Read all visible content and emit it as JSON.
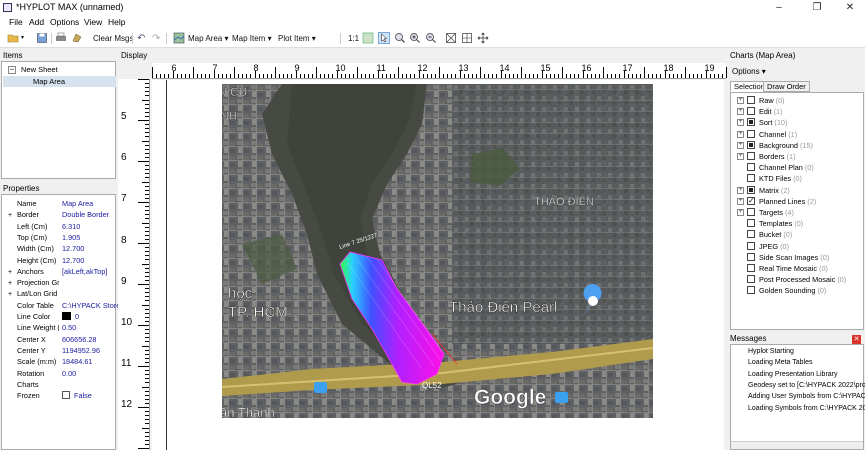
{
  "window": {
    "title": "*HYPLOT MAX (unnamed)"
  },
  "menu": [
    "File",
    "Add",
    "Options",
    "View",
    "Help"
  ],
  "toolbar": {
    "clear_msgs": "Clear Msgs",
    "map_area": "Map Area",
    "map_item": "Map Item",
    "plot_item": "Plot Item",
    "scale_1to1": "1:1"
  },
  "items": {
    "header": "Items",
    "sheet": "New Sheet",
    "map_area": "Map Area"
  },
  "properties": {
    "header": "Properties",
    "rows": [
      {
        "name": "Name",
        "value": "Map Area",
        "expand": ""
      },
      {
        "name": "Border",
        "value": "Double Border",
        "expand": "+"
      },
      {
        "name": "Left (Cm)",
        "value": "6.310",
        "expand": ""
      },
      {
        "name": "Top (Cm)",
        "value": "1.905",
        "expand": ""
      },
      {
        "name": "Width (Cm)",
        "value": "12.700",
        "expand": ""
      },
      {
        "name": "Height (Cm)",
        "value": "12.700",
        "expand": ""
      },
      {
        "name": "Anchors",
        "value": "[akLeft,akTop]",
        "expand": "+"
      },
      {
        "name": "Projection Gri",
        "value": "",
        "expand": "+"
      },
      {
        "name": "Lat/Lon Grid",
        "value": "",
        "expand": "+"
      },
      {
        "name": "Color Table",
        "value": "C:\\HYPACK Store",
        "expand": ""
      },
      {
        "name": "Line Color",
        "value": "0",
        "expand": ""
      },
      {
        "name": "Line Weight (",
        "value": "0.50",
        "expand": ""
      },
      {
        "name": "Center X",
        "value": "606656.28",
        "expand": ""
      },
      {
        "name": "Center Y",
        "value": "1194952.96",
        "expand": ""
      },
      {
        "name": "Scale (m:m)",
        "value": "18484.61",
        "expand": ""
      },
      {
        "name": "Rotation",
        "value": "0.00",
        "expand": ""
      },
      {
        "name": "Charts",
        "value": "",
        "expand": ""
      },
      {
        "name": "Frozen",
        "value": "False",
        "expand": ""
      }
    ]
  },
  "display": {
    "header": "Display",
    "h_ticks": [
      "6",
      "7",
      "8",
      "9",
      "10",
      "11",
      "12",
      "13",
      "14",
      "15",
      "16",
      "17",
      "18",
      "19"
    ],
    "v_ticks": [
      "5",
      "6",
      "7",
      "8",
      "9",
      "10",
      "11",
      "12"
    ]
  },
  "map": {
    "labels": [
      "N CƯ",
      "NH",
      "THẢO ĐIỀN",
      "học",
      "TP. HCM...",
      "Thảo Điền Pearl",
      "Google",
      "QL52",
      "ăn Thánh"
    ],
    "line_label": "Line 7 25/1227"
  },
  "charts": {
    "header": "Charts (Map Area)",
    "options": "Options",
    "tabs": [
      "Selection",
      "Draw Order"
    ],
    "rows": [
      {
        "label": "Raw",
        "count": "(0)",
        "expand": true,
        "check": "none"
      },
      {
        "label": "Edit",
        "count": "(1)",
        "expand": true,
        "check": "none"
      },
      {
        "label": "Sort",
        "count": "(10)",
        "expand": true,
        "check": "partial"
      },
      {
        "label": "Channel",
        "count": "(1)",
        "expand": true,
        "check": "none"
      },
      {
        "label": "Background",
        "count": "(15)",
        "expand": true,
        "check": "partial"
      },
      {
        "label": "Borders",
        "count": "(1)",
        "expand": true,
        "check": "none"
      },
      {
        "label": "Channel Plan",
        "count": "(0)",
        "expand": false,
        "check": "none"
      },
      {
        "label": "KTD Files",
        "count": "(0)",
        "expand": false,
        "check": "none"
      },
      {
        "label": "Matrix",
        "count": "(2)",
        "expand": true,
        "check": "partial"
      },
      {
        "label": "Planned Lines",
        "count": "(2)",
        "expand": true,
        "check": "tick"
      },
      {
        "label": "Targets",
        "count": "(4)",
        "expand": true,
        "check": "none"
      },
      {
        "label": "Templates",
        "count": "(0)",
        "expand": false,
        "check": "none"
      },
      {
        "label": "Bucket",
        "count": "(0)",
        "expand": false,
        "check": "none"
      },
      {
        "label": "JPEG",
        "count": "(0)",
        "expand": false,
        "check": "none"
      },
      {
        "label": "Side Scan Images",
        "count": "(0)",
        "expand": false,
        "check": "none"
      },
      {
        "label": "Real Time Mosaic",
        "count": "(0)",
        "expand": false,
        "check": "none"
      },
      {
        "label": "Post Processed Mosaic",
        "count": "(0)",
        "expand": false,
        "check": "none"
      },
      {
        "label": "Golden Sounding",
        "count": "(0)",
        "expand": false,
        "check": "none"
      }
    ]
  },
  "messages": {
    "header": "Messages",
    "items": [
      "Hyplot Starting",
      "Loading Meta Tables",
      "Loading Presentation Library",
      "Geodesy set to [C:\\HYPACK 2022\\proj",
      "Adding User Symbols from C:\\HYPACK",
      "Loading Symbols from C:\\HYPACK 2022"
    ]
  }
}
